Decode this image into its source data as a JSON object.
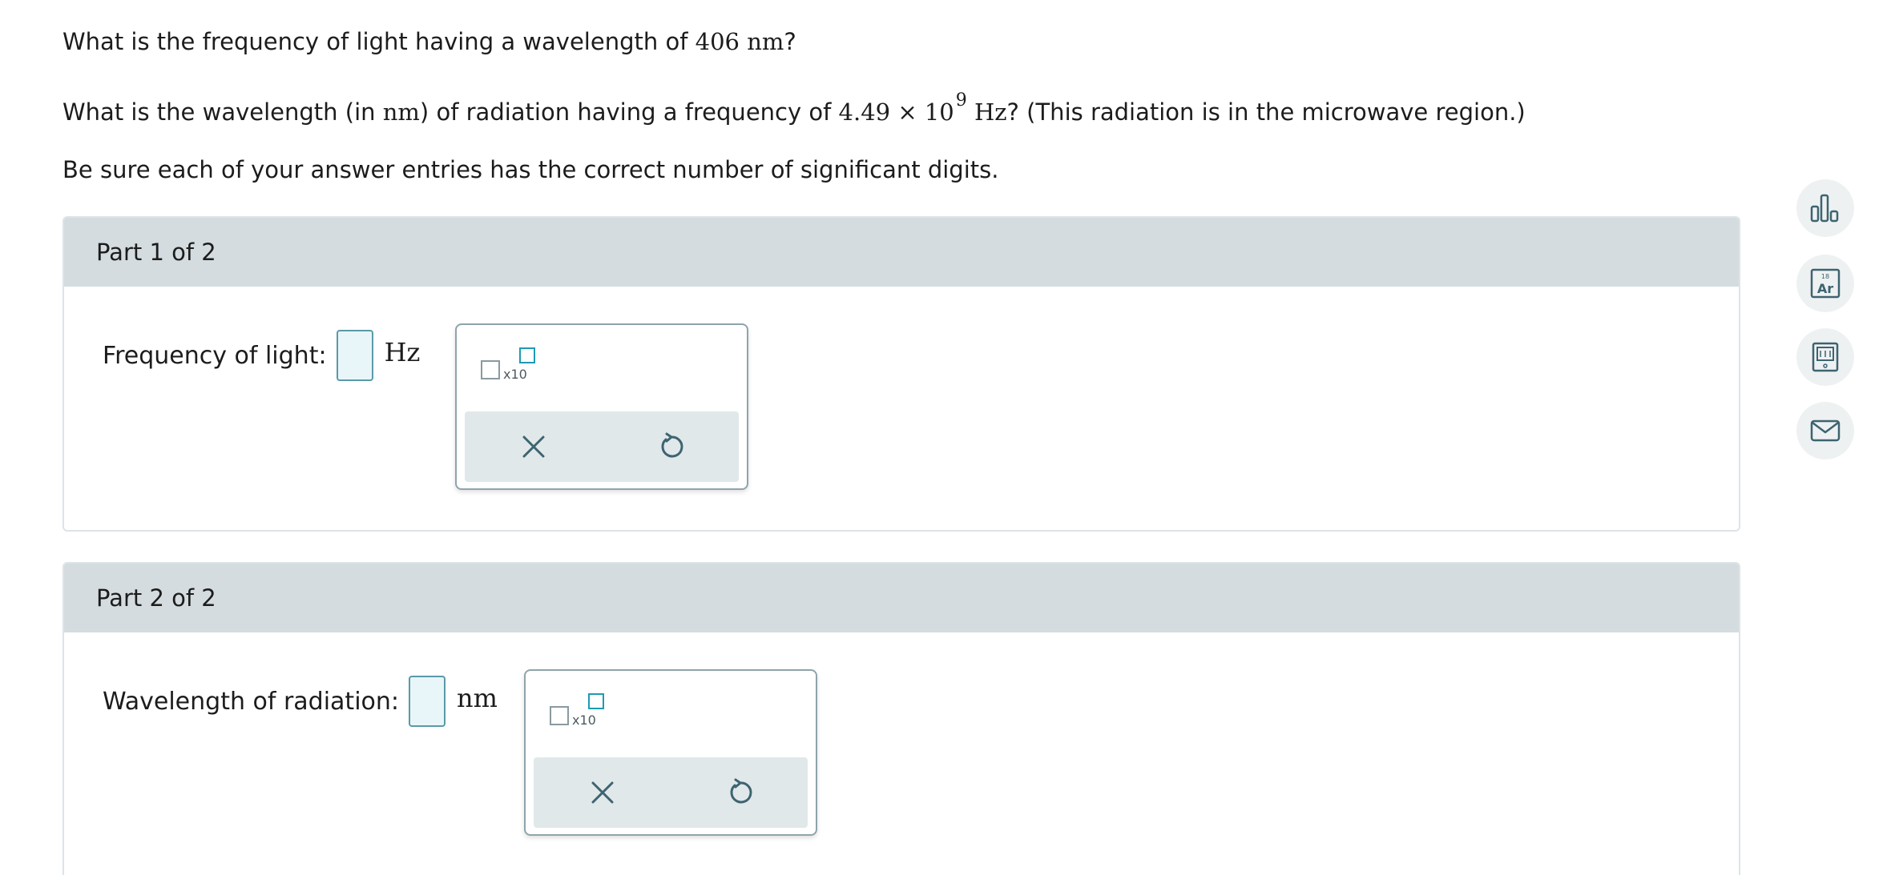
{
  "questions": {
    "q1": {
      "prefix": "What is the frequency of light having a wavelength of ",
      "value": "406 nm",
      "suffix": "?"
    },
    "q2": {
      "prefix": "What is the wavelength (in ",
      "unit": "nm",
      "middle": ") of radiation having a frequency of ",
      "mantissa": "4.49 × 10",
      "exponent": "9",
      "freq_unit": "Hz",
      "suffix": "? (This radiation is in the microwave region.)"
    },
    "q3": "Be sure each of your answer entries has the correct number of significant digits."
  },
  "parts": [
    {
      "header": "Part 1 of 2",
      "label": "Frequency of light:",
      "unit": "Hz",
      "sci_label": "x10"
    },
    {
      "header": "Part 2 of 2",
      "label": "Wavelength of radiation:",
      "unit": "nm",
      "sci_label": "x10"
    }
  ],
  "tools": [
    "bar-chart-icon",
    "periodic-table-icon",
    "calculator-book-icon",
    "mail-icon"
  ],
  "periodic_tile": {
    "number": "18",
    "symbol": "Ar"
  },
  "colors": {
    "header_bg": "#d4dcdf",
    "answer_border": "#5a9aa8",
    "answer_fill": "#e8f6f9",
    "exponent_accent": "#1d9bb3",
    "icon_color": "#3d6470"
  }
}
